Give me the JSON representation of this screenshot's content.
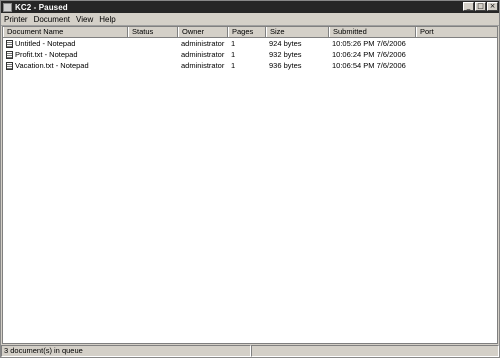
{
  "window": {
    "title": "KC2 - Paused",
    "min_glyph": "_",
    "max_glyph": "□",
    "close_glyph": "×"
  },
  "menu": [
    "Printer",
    "Document",
    "View",
    "Help"
  ],
  "columns": [
    "Document Name",
    "Status",
    "Owner",
    "Pages",
    "Size",
    "Submitted",
    "Port"
  ],
  "rows": [
    {
      "name": "Untitled - Notepad",
      "status": "",
      "owner": "administrator",
      "pages": "1",
      "size": "924 bytes",
      "submitted": "10:05:26 PM  7/6/2006",
      "port": ""
    },
    {
      "name": "Profit.txt - Notepad",
      "status": "",
      "owner": "administrator",
      "pages": "1",
      "size": "932 bytes",
      "submitted": "10:06:24 PM  7/6/2006",
      "port": ""
    },
    {
      "name": "Vacation.txt - Notepad",
      "status": "",
      "owner": "administrator",
      "pages": "1",
      "size": "936 bytes",
      "submitted": "10:06:54 PM  7/6/2006",
      "port": ""
    }
  ],
  "status": {
    "left": "3 document(s) in queue",
    "right": ""
  },
  "icons": {
    "app": "printer-icon",
    "doc": "notepad-document-icon"
  }
}
